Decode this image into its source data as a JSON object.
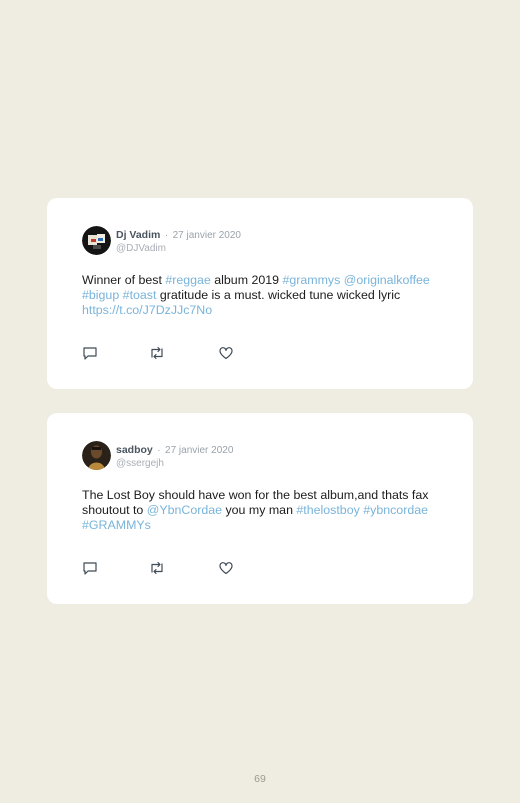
{
  "tweets": [
    {
      "name": "Dj Vadim",
      "separator": "·",
      "date": "27 janvier 2020",
      "handle": "@DJVadim",
      "avatar_icon": "dj-vadim-avatar",
      "body": [
        {
          "t": "Winner of best ",
          "link": false
        },
        {
          "t": "#reggae",
          "link": true
        },
        {
          "t": " album 2019 ",
          "link": false
        },
        {
          "t": "#grammys",
          "link": true
        },
        {
          "t": " ",
          "link": false
        },
        {
          "t": "@originalkoffee",
          "link": true
        },
        {
          "t": " ",
          "link": false
        },
        {
          "t": "#bigup",
          "link": true
        },
        {
          "t": " ",
          "link": false
        },
        {
          "t": "#toast",
          "link": true
        },
        {
          "t": " gratitude is a must. wicked tune wicked lyric ",
          "link": false
        },
        {
          "t": "https://t.co/J7DzJJc7No",
          "link": true
        }
      ]
    },
    {
      "name": "sadboy",
      "separator": "·",
      "date": "27 janvier 2020",
      "handle": "@ssergejh",
      "avatar_icon": "sadboy-avatar",
      "body": [
        {
          "t": "The Lost Boy should have won for the best album,and thats fax shoutout to ",
          "link": false
        },
        {
          "t": "@YbnCordae",
          "link": true
        },
        {
          "t": " you my man ",
          "link": false
        },
        {
          "t": "#thelostboy",
          "link": true
        },
        {
          "t": " ",
          "link": false
        },
        {
          "t": "#ybncordae",
          "link": true
        },
        {
          "t": " ",
          "link": false
        },
        {
          "t": "#GRAMMYs",
          "link": true
        }
      ]
    }
  ],
  "icons": {
    "reply": "reply-icon",
    "retweet": "retweet-icon",
    "like": "like-icon"
  },
  "colors": {
    "background": "#efece1",
    "card": "#ffffff",
    "link": "#79b4da",
    "text": "#1c1c1c"
  },
  "page_number": "69"
}
